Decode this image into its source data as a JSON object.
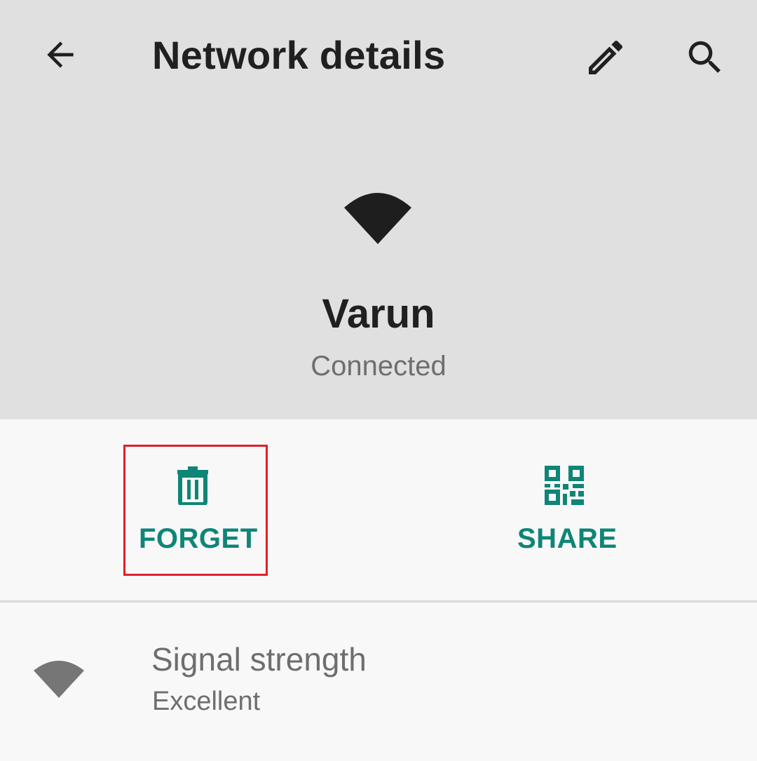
{
  "toolbar": {
    "title": "Network details",
    "back_icon": "arrow-back-icon",
    "edit_icon": "pencil-icon",
    "search_icon": "search-icon"
  },
  "network": {
    "icon": "wifi-icon",
    "name": "Varun",
    "status": "Connected"
  },
  "actions": {
    "forget": {
      "label": "FORGET",
      "icon": "trash-icon"
    },
    "share": {
      "label": "SHARE",
      "icon": "qr-code-icon"
    }
  },
  "details": [
    {
      "title": "Signal strength",
      "value": "Excellent",
      "icon": "wifi-signal-icon"
    }
  ],
  "colors": {
    "header_bg": "#e0e0e0",
    "accent": "#0e8577",
    "highlight": "#e0202a",
    "text_primary": "#202020",
    "text_secondary": "#6e6e6e"
  }
}
